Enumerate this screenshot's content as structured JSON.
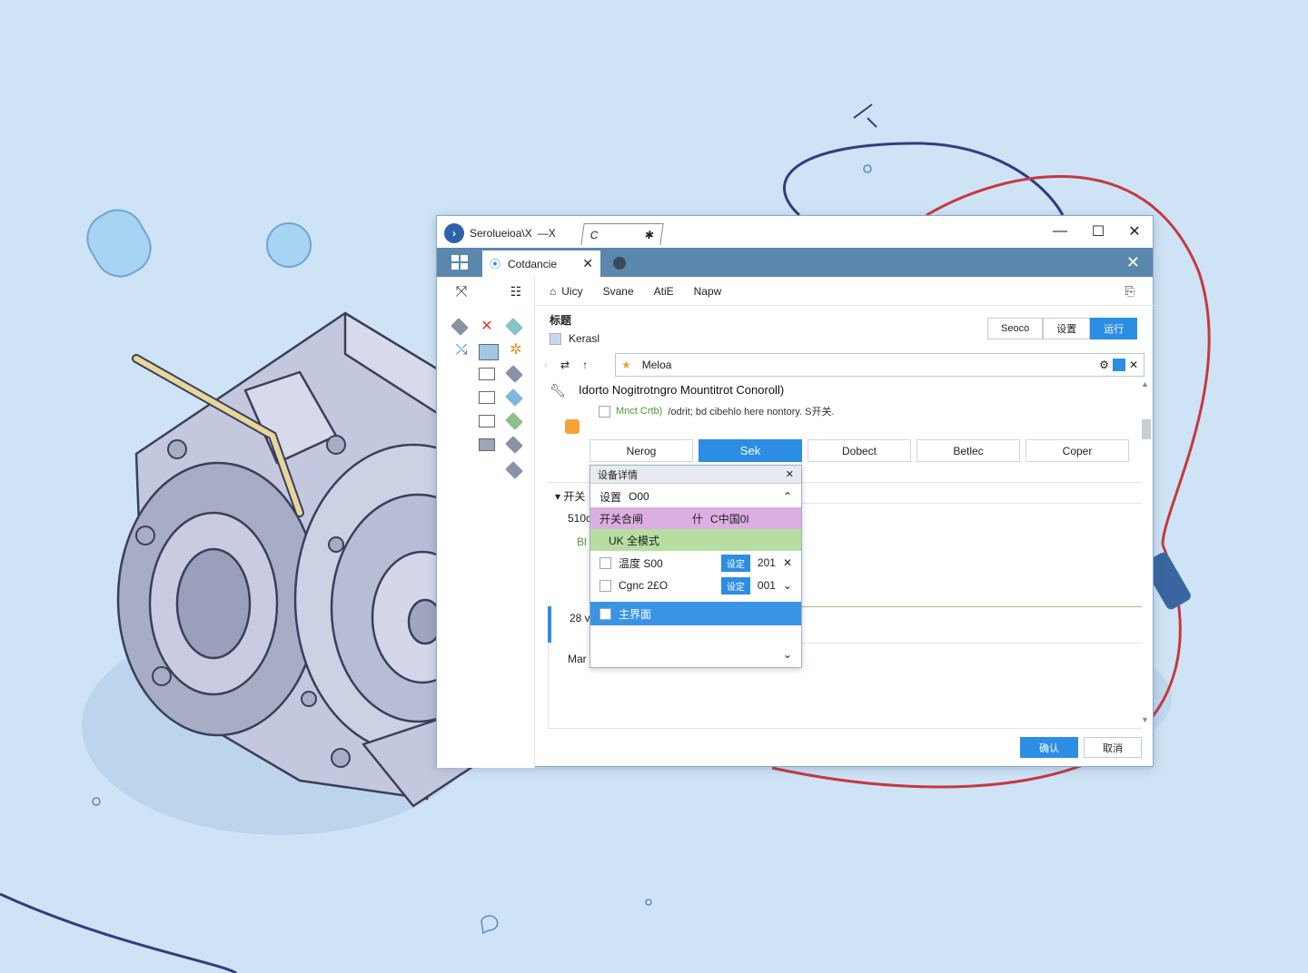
{
  "window": {
    "title_tab": "Serolueioa\\X",
    "title_tab_close": "—X",
    "second_tab": "C",
    "second_tab_icon": "pin-icon",
    "controls": {
      "minimize": "—",
      "maximize": "☐",
      "close": "✕"
    }
  },
  "tabstrip": {
    "doc_tab_label": "Cotdancie",
    "doc_tab_close": "✕",
    "strip_close": "✕"
  },
  "menubar": {
    "items": [
      "Uicy",
      "Svane",
      "AtiE",
      "Napw"
    ]
  },
  "section": {
    "heading": "标题",
    "checkbox_label": "Kerasl"
  },
  "segmented": {
    "items": [
      "Seoco",
      "设置",
      "运行"
    ],
    "active_index": 2
  },
  "search": {
    "value": "Meloa"
  },
  "description": {
    "title": "Idorto Nogitrotngro Mountitrot Conoroll)",
    "line_green": "Mnct Crtb)",
    "line_rest": "/odrit; bd cibehlo here nontory. S开关."
  },
  "buttons": {
    "items": [
      "Nerog",
      "Sek",
      "Dobect",
      "Betlec",
      "Coper"
    ],
    "active_index": 1
  },
  "left_labels": {
    "collapsed_header": "开关",
    "row1": "510c",
    "row2": "Bl",
    "row3": "28 v",
    "row4": "Mar"
  },
  "popup": {
    "header": "设备详情",
    "header_close": "✕",
    "rows": [
      {
        "label": "设置",
        "value": "O00",
        "end": "⌃"
      },
      {
        "label": "开关合闸",
        "value": "C中国0I",
        "prefix": "什"
      },
      {
        "label": "UK 全模式"
      },
      {
        "label": "温度 S00",
        "tag": "设定",
        "num": "201",
        "end": "✕"
      },
      {
        "label": "Cgnc 2£O",
        "tag": "设定",
        "num": "001",
        "end": "⌄"
      },
      {
        "label": "主界面"
      }
    ],
    "bottom_chevron": "⌄"
  },
  "footer": {
    "ok": "确认",
    "cancel": "取消"
  },
  "colors": {
    "accent": "#2c8de4",
    "tabstrip": "#5b87ad",
    "background": "#cfe3f6"
  }
}
